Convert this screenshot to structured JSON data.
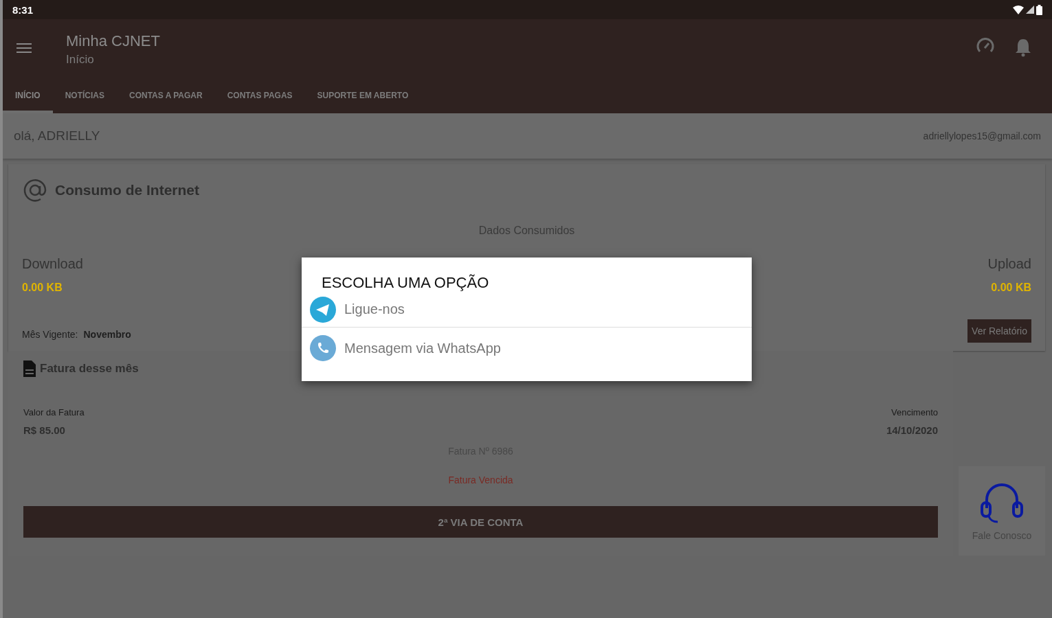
{
  "status_bar": {
    "time": "8:31"
  },
  "app_bar": {
    "title": "Minha CJNET",
    "subtitle": "Início"
  },
  "tabs": [
    {
      "label": "INÍCIO",
      "selected": true
    },
    {
      "label": "NOTÍCIAS",
      "selected": false
    },
    {
      "label": "CONTAS A PAGAR",
      "selected": false
    },
    {
      "label": "CONTAS PAGAS",
      "selected": false
    },
    {
      "label": "SUPORTE EM ABERTO",
      "selected": false
    }
  ],
  "greeting": {
    "text": "olá, ADRIELLY",
    "email": "adriellylopes15@gmail.com"
  },
  "usage_card": {
    "title": "Consumo de Internet",
    "subtitle": "Dados Consumidos",
    "download_label": "Download",
    "download_value": "0.00 KB",
    "upload_label": "Upload",
    "upload_value": "0.00 KB",
    "month_label": "Mês Vigente:",
    "month_value": "Novembro",
    "report_button": "Ver Relatório"
  },
  "invoice_card": {
    "title": "Fatura desse mês",
    "amount_label": "Valor da Fatura",
    "amount": "R$ 85.00",
    "due_label": "Vencimento",
    "due_date": "14/10/2020",
    "number": "Fatura Nº 6986",
    "status": "Fatura Vencida",
    "button": "2ª VIA DE CONTA"
  },
  "contact": {
    "label": "Fale Conosco"
  },
  "dialog": {
    "title": "ESCOLHA UMA OPÇÃO",
    "options": [
      {
        "kind": "telegram",
        "label": "Ligue-nos"
      },
      {
        "kind": "phone",
        "label": "Mensagem via WhatsApp"
      }
    ]
  }
}
